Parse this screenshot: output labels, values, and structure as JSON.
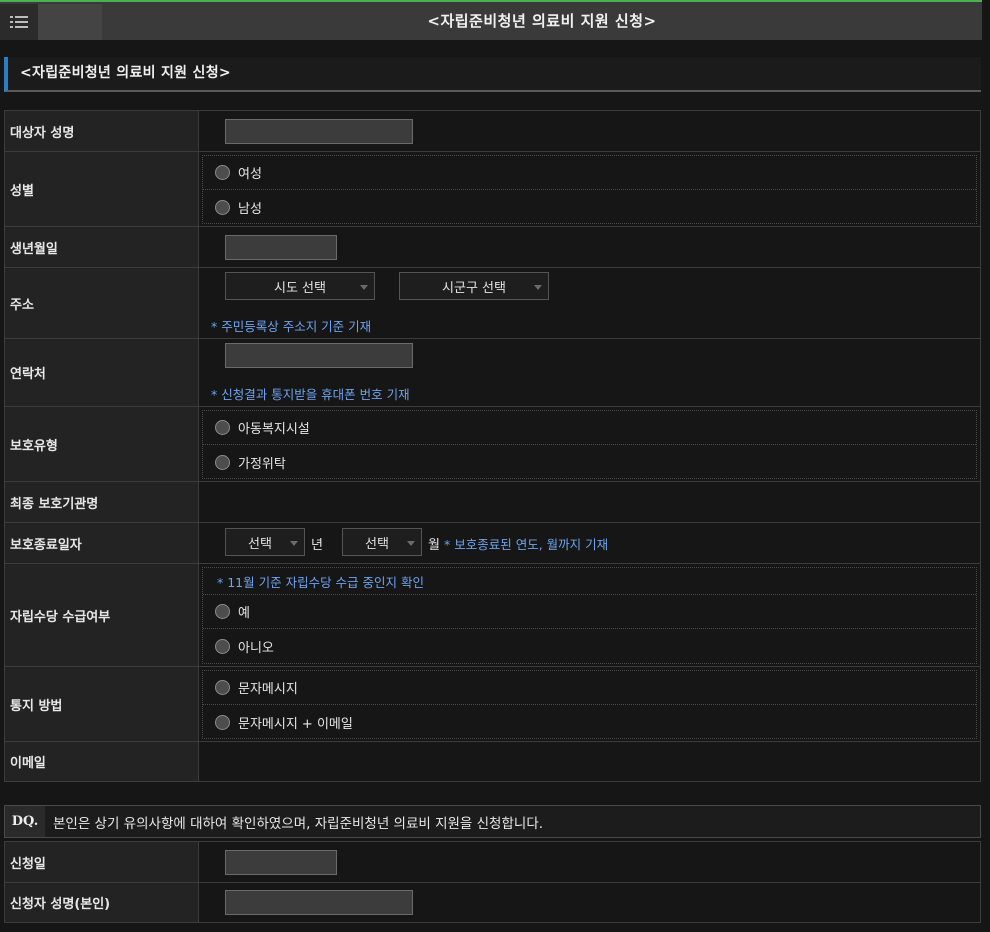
{
  "header": {
    "title": "<자립준비청년 의료비 지원 신청>",
    "menu_icon": "list-icon"
  },
  "section": {
    "title": "<자립준비청년 의료비 지원 신청>"
  },
  "form": {
    "name_label": "대상자 성명",
    "name_value": "",
    "gender_label": "성별",
    "gender_options": [
      "여성",
      "남성"
    ],
    "birth_label": "생년월일",
    "birth_value": "",
    "address_label": "주소",
    "address_sido": "시도 선택",
    "address_sigungu": "시군구 선택",
    "address_note": "* 주민등록상 주소지 기준 기재",
    "contact_label": "연락처",
    "contact_value": "",
    "contact_note": "* 신청결과 통지받을 휴대폰 번호 기재",
    "protection_type_label": "보호유형",
    "protection_type_options": [
      "아동복지시설",
      "가정위탁"
    ],
    "last_institution_label": "최종 보호기관명",
    "protection_end_label": "보호종료일자",
    "protection_end_year": "선택",
    "year_suffix": "년",
    "protection_end_month": "선택",
    "month_suffix": "월",
    "protection_end_note": "* 보호종료된 연도, 월까지 기재",
    "allowance_label": "자립수당 수급여부",
    "allowance_note": "* 11월 기준 자립수당 수급 중인지 확인",
    "allowance_options": [
      "예",
      "아니오"
    ],
    "notify_label": "통지 방법",
    "notify_options": [
      "문자메시지",
      "문자메시지 + 이메일"
    ],
    "email_label": "이메일"
  },
  "declaration": {
    "tag": "DQ.",
    "text": "본인은 상기 유의사항에 대하여 확인하였으며, 자립준비청년 의료비 지원을 신청합니다."
  },
  "signature": {
    "date_label": "신청일",
    "date_value": "",
    "applicant_label": "신청자 성명(본인)",
    "applicant_value": ""
  }
}
